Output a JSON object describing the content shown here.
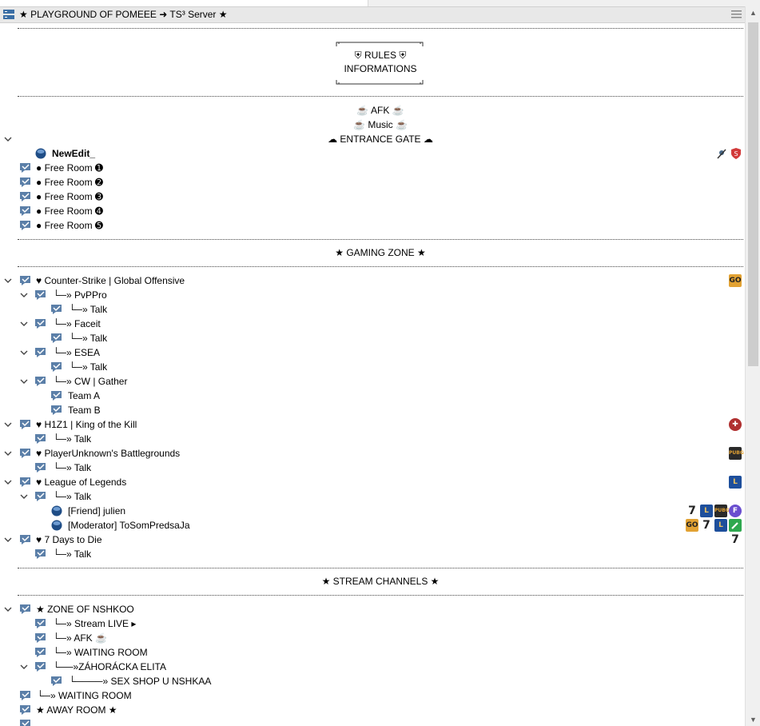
{
  "header": {
    "title": "★ PLAYGROUND OF POMEEE ➜ TS³ Server ★"
  },
  "rules": {
    "line1": "⛨ RULES ⛨",
    "line2": "INFORMATIONS"
  },
  "channels": {
    "afk": "☕ AFK ☕",
    "music": "☕ Music ☕",
    "entrance": "☁ ENTRANCE GATE ☁",
    "gaming_zone": "★ GAMING ZONE ★",
    "stream_channels": "★ STREAM CHANNELS ★"
  },
  "entrance": {
    "user": "NewEdit_",
    "rooms": [
      "● Free Room ➊",
      "● Free Room ➋",
      "● Free Room ➌",
      "● Free Room ➍",
      "● Free Room ➎"
    ]
  },
  "gaming": {
    "csgo": "♥ Counter-Strike | Global Offensive",
    "pvppro": "└─» PvPPro",
    "pvppro_talk": "└─» Talk",
    "faceit": "└─» Faceit",
    "faceit_talk": "└─» Talk",
    "esea": "└─» ESEA",
    "esea_talk": "└─» Talk",
    "cw": "└─» CW | Gather",
    "team_a": "Team A",
    "team_b": "Team B",
    "h1z1": "♥ H1Z1 | King of the Kill",
    "h1z1_talk": "└─» Talk",
    "pubg": "♥ PlayerUnknown's Battlegrounds",
    "pubg_talk": "└─» Talk",
    "lol": "♥ League of Legends",
    "lol_talk": "└─» Talk",
    "lol_user1": "[Friend] julien",
    "lol_user2": "[Moderator] ToSomPredsaJa",
    "days": "♥ 7 Days to Die",
    "days_talk": "└─» Talk"
  },
  "stream": {
    "zone": "★ ZONE OF NSHKOO",
    "live": "└─» Stream LIVE ▸",
    "afk": "└─» AFK ☕",
    "waiting": "└─» WAITING ROOM",
    "elita": "└──»ZÁHORÁCKA ELITA",
    "sexshop": "└────» SEX SHOP U NSHKAA",
    "waiting2": "└─» WAITING ROOM",
    "away": "★ AWAY ROOM ★"
  },
  "badges": {
    "csgo": "GO",
    "pubg": "PUBG",
    "lol": "L",
    "days": "7",
    "faceit": "F",
    "h1z1": "✚"
  },
  "colors": {
    "header_bg": "#e8e8e8",
    "channel_icon": "#5b7fa8",
    "lol_blue": "#1e4f9c",
    "csgo_orange": "#e2a233",
    "user_dot": "#1f4d86"
  }
}
